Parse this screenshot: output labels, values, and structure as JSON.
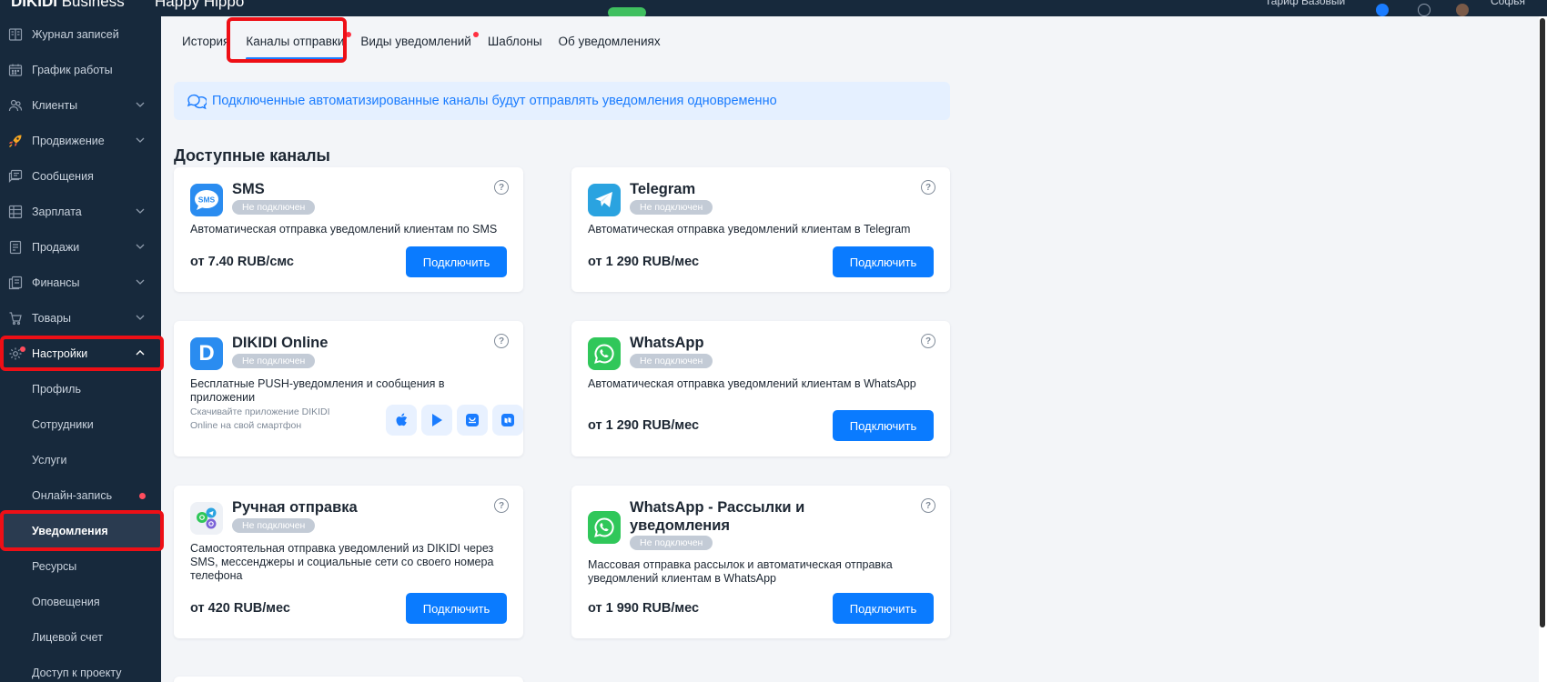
{
  "topbar": {
    "brand_bold": "DIKIDI",
    "brand_light": " Business",
    "company": "Happy Hippo",
    "tariff": "Тариф Базовый",
    "user": "Софья"
  },
  "sidebar": {
    "items": [
      {
        "label": "Журнал записей",
        "icon": "journal-icon"
      },
      {
        "label": "График работы",
        "icon": "calendar-icon"
      },
      {
        "label": "Клиенты",
        "icon": "clients-icon"
      },
      {
        "label": "Продвижение",
        "icon": "rocket-icon"
      },
      {
        "label": "Сообщения",
        "icon": "messages-icon"
      },
      {
        "label": "Зарплата",
        "icon": "salary-icon"
      },
      {
        "label": "Продажи",
        "icon": "sales-icon"
      },
      {
        "label": "Финансы",
        "icon": "finance-icon"
      },
      {
        "label": "Товары",
        "icon": "goods-icon"
      },
      {
        "label": "Настройки",
        "icon": "gear-icon"
      }
    ],
    "sub_items": [
      {
        "label": "Профиль"
      },
      {
        "label": "Сотрудники"
      },
      {
        "label": "Услуги"
      },
      {
        "label": "Онлайн-запись"
      },
      {
        "label": "Уведомления"
      },
      {
        "label": "Ресурсы"
      },
      {
        "label": "Оповещения"
      },
      {
        "label": "Лицевой счет"
      },
      {
        "label": "Доступ к проекту"
      }
    ]
  },
  "tabs": [
    {
      "label": "История"
    },
    {
      "label": "Каналы отправки"
    },
    {
      "label": "Виды уведомлений"
    },
    {
      "label": "Шаблоны"
    },
    {
      "label": "Об уведомлениях"
    }
  ],
  "notice": "Подключенные автоматизированные каналы будут отправлять уведомления одновременно",
  "section_title": "Доступные каналы",
  "status_label": "Не подключен",
  "connect_label": "Подключить",
  "help_glyph": "?",
  "cards": {
    "sms": {
      "title": "SMS",
      "desc": "Автоматическая отправка уведомлений клиентам по SMS",
      "price": "от 7.40 RUB/смс",
      "icon_text": "SMS"
    },
    "telegram": {
      "title": "Telegram",
      "desc": "Автоматическая отправка уведомлений клиентам в Telegram",
      "price": "от 1 290 RUB/мес"
    },
    "dikidi": {
      "title": "DIKIDI Online",
      "desc": "Бесплатные PUSH-уведомления и сообщения в приложении",
      "download": "Скачивайте приложение DIKIDI Online на свой смартфон",
      "icon_text": "D"
    },
    "whatsapp": {
      "title": "WhatsApp",
      "desc": "Автоматическая отправка уведомлений клиентам в WhatsApp",
      "price": "от 1 290 RUB/мес"
    },
    "manual": {
      "title": "Ручная отправка",
      "desc": "Самостоятельная отправка уведомлений из DIKIDI через SMS, мессенджеры и социальные сети со своего номера телефона",
      "price": "от 420 RUB/мес"
    },
    "whatsapp_mass": {
      "title": "WhatsApp - Рассылки и уведомления",
      "desc": "Массовая отправка рассылок и автоматическая отправка уведомлений клиентам в WhatsApp",
      "price": "от 1 990 RUB/мес"
    }
  },
  "colors": {
    "sidebar_bg": "#17293c",
    "accent": "#0a7bff",
    "highlight": "#ee0f16",
    "badge_bg": "#c3cbd6"
  }
}
